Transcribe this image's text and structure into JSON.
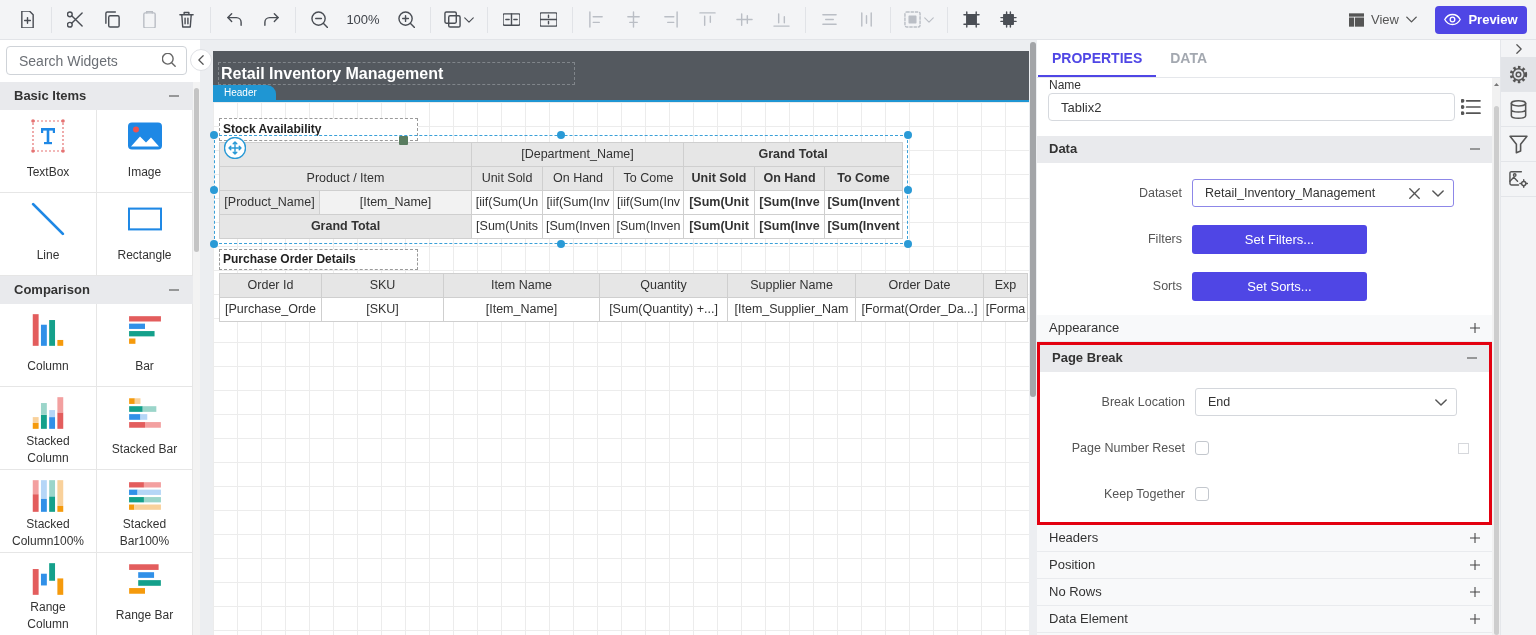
{
  "toolbar": {
    "groups": [
      [
        {
          "kind": "button",
          "disabled": false
        }
      ],
      [
        {
          "kind": "button",
          "disabled": false
        },
        {
          "kind": "button",
          "disabled": false
        },
        {
          "kind": "button",
          "disabled": true
        },
        {
          "kind": "button",
          "disabled": false
        }
      ],
      [
        {
          "kind": "button",
          "disabled": false
        },
        {
          "kind": "button",
          "disabled": false
        }
      ],
      [
        {
          "kind": "button",
          "disabled": false
        },
        {
          "kind": "label",
          "text": "100%"
        },
        {
          "kind": "button",
          "disabled": false
        }
      ],
      [
        {
          "kind": "menu",
          "disabled": false
        }
      ],
      [
        {
          "kind": "button",
          "disabled": false
        },
        {
          "kind": "button",
          "disabled": false
        }
      ],
      [
        {
          "kind": "button",
          "disabled": true
        },
        {
          "kind": "button",
          "disabled": true
        },
        {
          "kind": "button",
          "disabled": true
        },
        {
          "kind": "button",
          "disabled": true
        },
        {
          "kind": "button",
          "disabled": true
        },
        {
          "kind": "button",
          "disabled": true
        }
      ],
      [
        {
          "kind": "button",
          "disabled": true
        },
        {
          "kind": "button",
          "disabled": true
        }
      ],
      [
        {
          "kind": "menu",
          "disabled": true
        }
      ],
      [
        {
          "kind": "button",
          "disabled": false
        },
        {
          "kind": "button",
          "disabled": false
        }
      ]
    ],
    "view": "View",
    "preview": "Preview"
  },
  "widgets": {
    "search": {
      "placeholder": "Search Widgets"
    },
    "sections": [
      {
        "title": "Basic Items",
        "expanded": true,
        "items": [
          "TextBox",
          "Image",
          "Line",
          "Rectangle"
        ]
      },
      {
        "title": "Comparison",
        "expanded": true,
        "items": [
          "Column",
          "Bar",
          "Stacked Column",
          "Stacked Bar",
          "Stacked Column100%",
          "Stacked Bar100%",
          "Range Column",
          "Range Bar"
        ]
      }
    ]
  },
  "designer": {
    "header": {
      "title": "Retail Inventory Management",
      "band": "Header"
    },
    "tables": [
      {
        "title": "Stock Availability",
        "selected": true,
        "rows": [
          [
            {
              "colspan": 2,
              "kind": "header"
            },
            {
              "text": "[Department_Name]",
              "colspan": 3,
              "kind": "header",
              "bold": false
            },
            {
              "text": "Grand Total",
              "colspan": 3,
              "kind": "header",
              "bold": true
            }
          ],
          [
            {
              "text": "Product / Item",
              "colspan": 2,
              "kind": "header",
              "bold": false
            },
            {
              "text": "Unit Sold",
              "kind": "header",
              "bold": false
            },
            {
              "text": "On Hand",
              "kind": "header",
              "bold": false
            },
            {
              "text": "To Come",
              "kind": "header",
              "bold": false
            },
            {
              "text": "Unit Sold",
              "kind": "header",
              "bold": true
            },
            {
              "text": "On Hand",
              "kind": "header",
              "bold": true
            },
            {
              "text": "To Come",
              "kind": "header",
              "bold": true
            }
          ],
          [
            {
              "text": "[Product_Name]",
              "kind": "header",
              "bold": false
            },
            {
              "text": "[Item_Name]",
              "kind": "group",
              "bold": false
            },
            {
              "text": "[iif(Sum(Un",
              "kind": "data",
              "bold": false
            },
            {
              "text": "[iif(Sum(Inv",
              "kind": "data",
              "bold": false
            },
            {
              "text": "[iif(Sum(Inv",
              "kind": "data",
              "bold": false
            },
            {
              "text": "[Sum(Unit",
              "kind": "data",
              "bold": true
            },
            {
              "text": "[Sum(Inve",
              "kind": "data",
              "bold": true
            },
            {
              "text": "[Sum(Invent",
              "kind": "data",
              "bold": true
            }
          ],
          [
            {
              "text": "Grand Total",
              "colspan": 2,
              "kind": "header",
              "bold": true
            },
            {
              "text": "[Sum(Units",
              "kind": "data",
              "bold": false
            },
            {
              "text": "[Sum(Inven",
              "kind": "data",
              "bold": false
            },
            {
              "text": "[Sum(Inven",
              "kind": "data",
              "bold": false
            },
            {
              "text": "[Sum(Unit",
              "kind": "data",
              "bold": true
            },
            {
              "text": "[Sum(Inve",
              "kind": "data",
              "bold": true
            },
            {
              "text": "[Sum(Invent",
              "kind": "data",
              "bold": true
            }
          ]
        ]
      },
      {
        "title": "Purchase Order Details",
        "selected": false,
        "rows": [
          [
            {
              "text": "Order Id",
              "kind": "header",
              "bold": false
            },
            {
              "text": "SKU",
              "kind": "header",
              "bold": false
            },
            {
              "text": "Item Name",
              "kind": "header",
              "bold": false
            },
            {
              "text": "Quantity",
              "kind": "header",
              "bold": false
            },
            {
              "text": "Supplier Name",
              "kind": "header",
              "bold": false
            },
            {
              "text": "Order Date",
              "kind": "header",
              "bold": false
            },
            {
              "text": "Exp",
              "kind": "header",
              "bold": false
            }
          ],
          [
            {
              "text": "[Purchase_Orde",
              "kind": "data",
              "bold": false
            },
            {
              "text": "[SKU]",
              "kind": "data",
              "bold": false
            },
            {
              "text": "[Item_Name]",
              "kind": "data",
              "bold": false
            },
            {
              "text": "[Sum(Quantity) +...]",
              "kind": "data",
              "bold": false
            },
            {
              "text": "[Item_Supplier_Nam",
              "kind": "data",
              "bold": false
            },
            {
              "text": "[Format(Order_Da...]",
              "kind": "data",
              "bold": false
            },
            {
              "text": "[Forma",
              "kind": "data",
              "bold": false
            }
          ]
        ]
      }
    ]
  },
  "properties": {
    "tabs": [
      {
        "label": "PROPERTIES",
        "selected": true
      },
      {
        "label": "DATA",
        "selected": false
      }
    ],
    "name_field": {
      "label": "Name",
      "value": "Tablix2"
    },
    "sections": [
      {
        "title": "Data",
        "expanded": true,
        "highlighted": false,
        "fields": [
          {
            "kind": "select",
            "label": "Dataset",
            "value": "Retail_Inventory_Management",
            "focused": true,
            "clearable": true
          },
          {
            "kind": "button",
            "label": "Filters",
            "button": "Set Filters..."
          },
          {
            "kind": "button",
            "label": "Sorts",
            "button": "Set Sorts..."
          }
        ]
      },
      {
        "title": "Appearance",
        "expanded": false,
        "highlighted": false
      },
      {
        "title": "Page Break",
        "expanded": true,
        "highlighted": true,
        "fields": [
          {
            "kind": "select",
            "label": "Break Location",
            "value": "End",
            "focused": false,
            "clearable": false
          },
          {
            "kind": "checkbox",
            "label": "Page Number Reset",
            "checked": false,
            "extra_checkbox": {
              "checked": false
            }
          },
          {
            "kind": "checkbox",
            "label": "Keep Together",
            "checked": false
          }
        ]
      },
      {
        "title": "Headers",
        "expanded": false,
        "highlighted": false
      },
      {
        "title": "Position",
        "expanded": false,
        "highlighted": false
      },
      {
        "title": "No Rows",
        "expanded": false,
        "highlighted": false
      },
      {
        "title": "Data Element",
        "expanded": false,
        "highlighted": false
      }
    ]
  },
  "rail": {
    "items": [
      {
        "selected": true
      },
      {
        "selected": false
      },
      {
        "selected": false
      },
      {
        "selected": false
      }
    ]
  }
}
